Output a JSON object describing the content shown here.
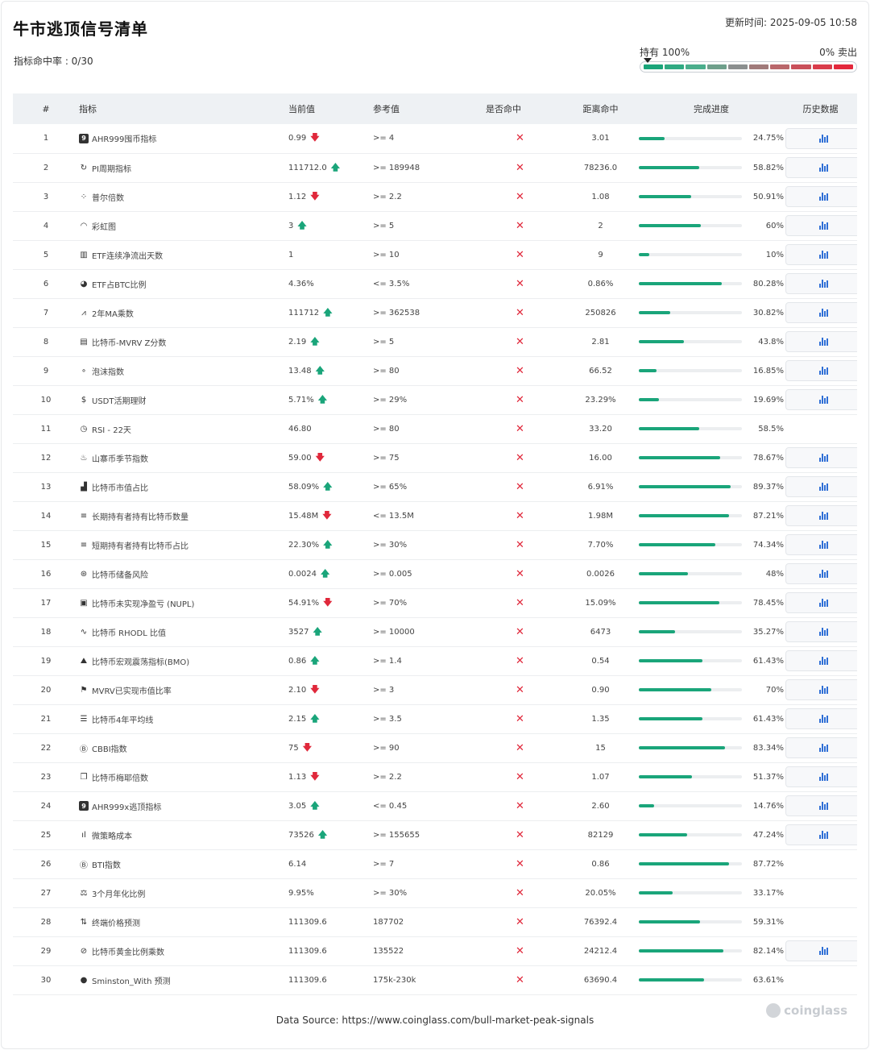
{
  "header": {
    "title": "牛市逃顶信号清单",
    "hit_rate": "指标命中率 : 0/30",
    "updated": "更新时间: 2025-09-05 10:58"
  },
  "gauge": {
    "left_label": "持有 100%",
    "right_label": "0% 卖出",
    "colors": [
      "#1aa57a",
      "#2faa82",
      "#4aae8c",
      "#6e9f8b",
      "#8b8f8f",
      "#a07a7a",
      "#b9676b",
      "#c9505a",
      "#d93c4b",
      "#e3283c"
    ]
  },
  "columns": [
    "#",
    "指标",
    "当前值",
    "参考值",
    "是否命中",
    "距离命中",
    "完成进度",
    "历史数据"
  ],
  "miss_mark": "✕",
  "rows": [
    {
      "idx": "1",
      "icon": "9",
      "icon_name": "ahr999-icon",
      "sq": true,
      "name": "AHR999囤币指标",
      "value": "0.99",
      "trend": "down",
      "ref": ">= 4",
      "distance": "3.01",
      "progress": 24.75,
      "pct": "24.75%",
      "history": true
    },
    {
      "idx": "2",
      "icon": "↻",
      "icon_name": "cycle-icon",
      "name": "PI周期指标",
      "value": "111712.0",
      "trend": "up",
      "ref": ">= 189948",
      "distance": "78236.0",
      "progress": 58.82,
      "pct": "58.82%",
      "history": true
    },
    {
      "idx": "3",
      "icon": "⁘",
      "icon_name": "multiple-icon",
      "name": "普尔倍数",
      "value": "1.12",
      "trend": "down",
      "ref": ">= 2.2",
      "distance": "1.08",
      "progress": 50.91,
      "pct": "50.91%",
      "history": true
    },
    {
      "idx": "4",
      "icon": "◠",
      "icon_name": "rainbow-icon",
      "name": "彩虹图",
      "value": "3",
      "trend": "up",
      "ref": ">= 5",
      "distance": "2",
      "progress": 60,
      "pct": "60%",
      "history": true
    },
    {
      "idx": "5",
      "icon": "▥",
      "icon_name": "bar-chart-icon",
      "name": "ETF连续净流出天数",
      "value": "1",
      "trend": "",
      "ref": ">= 10",
      "distance": "9",
      "progress": 10,
      "pct": "10%",
      "history": true
    },
    {
      "idx": "6",
      "icon": "◕",
      "icon_name": "pie-chart-icon",
      "name": "ETF占BTC比例",
      "value": "4.36%",
      "trend": "",
      "ref": "<= 3.5%",
      "distance": "0.86%",
      "progress": 80.28,
      "pct": "80.28%",
      "history": true
    },
    {
      "idx": "7",
      "icon": "⩘",
      "icon_name": "line-chart-icon",
      "name": "2年MA乘数",
      "value": "111712",
      "trend": "up",
      "ref": ">= 362538",
      "distance": "250826",
      "progress": 30.82,
      "pct": "30.82%",
      "history": true
    },
    {
      "idx": "8",
      "icon": "▤",
      "icon_name": "clipboard-icon",
      "name": "比特币-MVRV Z分数",
      "value": "2.19",
      "trend": "up",
      "ref": ">= 5",
      "distance": "2.81",
      "progress": 43.8,
      "pct": "43.8%",
      "history": true
    },
    {
      "idx": "9",
      "icon": "∘",
      "icon_name": "bubble-icon",
      "name": "泡沫指数",
      "value": "13.48",
      "trend": "up",
      "ref": ">= 80",
      "distance": "66.52",
      "progress": 16.85,
      "pct": "16.85%",
      "history": true
    },
    {
      "idx": "10",
      "icon": "$",
      "icon_name": "dollar-icon",
      "name": "USDT活期理财",
      "value": "5.71%",
      "trend": "up",
      "ref": ">= 29%",
      "distance": "23.29%",
      "progress": 19.69,
      "pct": "19.69%",
      "history": true
    },
    {
      "idx": "11",
      "icon": "◷",
      "icon_name": "clock-icon",
      "name": "RSI - 22天",
      "value": "46.80",
      "trend": "",
      "ref": ">= 80",
      "distance": "33.20",
      "progress": 58.5,
      "pct": "58.5%",
      "history": false
    },
    {
      "idx": "12",
      "icon": "♨",
      "icon_name": "flame-icon",
      "name": "山寨币季节指数",
      "value": "59.00",
      "trend": "down",
      "ref": ">= 75",
      "distance": "16.00",
      "progress": 78.67,
      "pct": "78.67%",
      "history": true
    },
    {
      "idx": "13",
      "icon": "▟",
      "icon_name": "signal-icon",
      "name": "比特币市值占比",
      "value": "58.09%",
      "trend": "up",
      "ref": ">= 65%",
      "distance": "6.91%",
      "progress": 89.37,
      "pct": "89.37%",
      "history": true
    },
    {
      "idx": "14",
      "icon": "≡",
      "icon_name": "database-icon",
      "name": "长期持有者持有比特币数量",
      "value": "15.48M",
      "trend": "down",
      "ref": "<= 13.5M",
      "distance": "1.98M",
      "progress": 87.21,
      "pct": "87.21%",
      "history": true
    },
    {
      "idx": "15",
      "icon": "≡",
      "icon_name": "database-icon",
      "name": "短期持有者持有比特币占比",
      "value": "22.30%",
      "trend": "up",
      "ref": ">= 30%",
      "distance": "7.70%",
      "progress": 74.34,
      "pct": "74.34%",
      "history": true
    },
    {
      "idx": "16",
      "icon": "⊛",
      "icon_name": "coins-icon",
      "name": "比特币储备风险",
      "value": "0.0024",
      "trend": "up",
      "ref": ">= 0.005",
      "distance": "0.0026",
      "progress": 48,
      "pct": "48%",
      "history": true
    },
    {
      "idx": "17",
      "icon": "▣",
      "icon_name": "calculator-icon",
      "name": "比特币未实现净盈亏 (NUPL)",
      "value": "54.91%",
      "trend": "down",
      "ref": ">= 70%",
      "distance": "15.09%",
      "progress": 78.45,
      "pct": "78.45%",
      "history": true
    },
    {
      "idx": "18",
      "icon": "∿",
      "icon_name": "pulse-icon",
      "name": "比特币 RHODL 比值",
      "value": "3527",
      "trend": "up",
      "ref": ">= 10000",
      "distance": "6473",
      "progress": 35.27,
      "pct": "35.27%",
      "history": true
    },
    {
      "idx": "19",
      "icon": "⛰",
      "icon_name": "mountain-icon",
      "name": "比特币宏观震荡指标(BMO)",
      "value": "0.86",
      "trend": "up",
      "ref": ">= 1.4",
      "distance": "0.54",
      "progress": 61.43,
      "pct": "61.43%",
      "history": true
    },
    {
      "idx": "20",
      "icon": "⚑",
      "icon_name": "flag-icon",
      "name": "MVRV已实现市值比率",
      "value": "2.10",
      "trend": "down",
      "ref": ">= 3",
      "distance": "0.90",
      "progress": 70,
      "pct": "70%",
      "history": true
    },
    {
      "idx": "21",
      "icon": "☰",
      "icon_name": "list-icon",
      "name": "比特币4年平均线",
      "value": "2.15",
      "trend": "up",
      "ref": ">= 3.5",
      "distance": "1.35",
      "progress": 61.43,
      "pct": "61.43%",
      "history": true
    },
    {
      "idx": "22",
      "icon": "Ⓑ",
      "icon_name": "coin-b-icon",
      "name": "CBBI指数",
      "value": "75",
      "trend": "down",
      "ref": ">= 90",
      "distance": "15",
      "progress": 83.34,
      "pct": "83.34%",
      "history": true
    },
    {
      "idx": "23",
      "icon": "❐",
      "icon_name": "copy-icon",
      "name": "比特币梅耶倍数",
      "value": "1.13",
      "trend": "down",
      "ref": ">= 2.2",
      "distance": "1.07",
      "progress": 51.37,
      "pct": "51.37%",
      "history": true
    },
    {
      "idx": "24",
      "icon": "9",
      "icon_name": "ahr999-icon",
      "sq": true,
      "name": "AHR999x逃顶指标",
      "value": "3.05",
      "trend": "up",
      "ref": "<= 0.45",
      "distance": "2.60",
      "progress": 14.76,
      "pct": "14.76%",
      "history": true
    },
    {
      "idx": "25",
      "icon": "ıl",
      "icon_name": "chart-bars-icon",
      "name": "微策略成本",
      "value": "73526",
      "trend": "up",
      "ref": ">= 155655",
      "distance": "82129",
      "progress": 47.24,
      "pct": "47.24%",
      "history": true
    },
    {
      "idx": "26",
      "icon": "Ⓑ",
      "icon_name": "coin-b-icon",
      "name": "BTI指数",
      "value": "6.14",
      "trend": "",
      "ref": ">= 7",
      "distance": "0.86",
      "progress": 87.72,
      "pct": "87.72%",
      "history": false
    },
    {
      "idx": "27",
      "icon": "⚖",
      "icon_name": "scale-icon",
      "name": "3个月年化比例",
      "value": "9.95%",
      "trend": "",
      "ref": ">= 30%",
      "distance": "20.05%",
      "progress": 33.17,
      "pct": "33.17%",
      "history": false
    },
    {
      "idx": "28",
      "icon": "⇅",
      "icon_name": "price-icon",
      "name": "终端价格预测",
      "value": "111309.6",
      "trend": "",
      "ref": "187702",
      "distance": "76392.4",
      "progress": 59.31,
      "pct": "59.31%",
      "history": false
    },
    {
      "idx": "29",
      "icon": "⊘",
      "icon_name": "gold-ratio-icon",
      "name": "比特币黄金比例乘数",
      "value": "111309.6",
      "trend": "",
      "ref": "135522",
      "distance": "24212.4",
      "progress": 82.14,
      "pct": "82.14%",
      "history": true
    },
    {
      "idx": "30",
      "icon": "●",
      "icon_name": "sminston-icon",
      "name": "Sminston_With 预测",
      "value": "111309.6",
      "trend": "",
      "ref": "175k-230k",
      "distance": "63690.4",
      "progress": 63.61,
      "pct": "63.61%",
      "history": false
    }
  ],
  "footer": {
    "source": "Data Source: https://www.coinglass.com/bull-market-peak-signals",
    "brand": "coinglass"
  }
}
